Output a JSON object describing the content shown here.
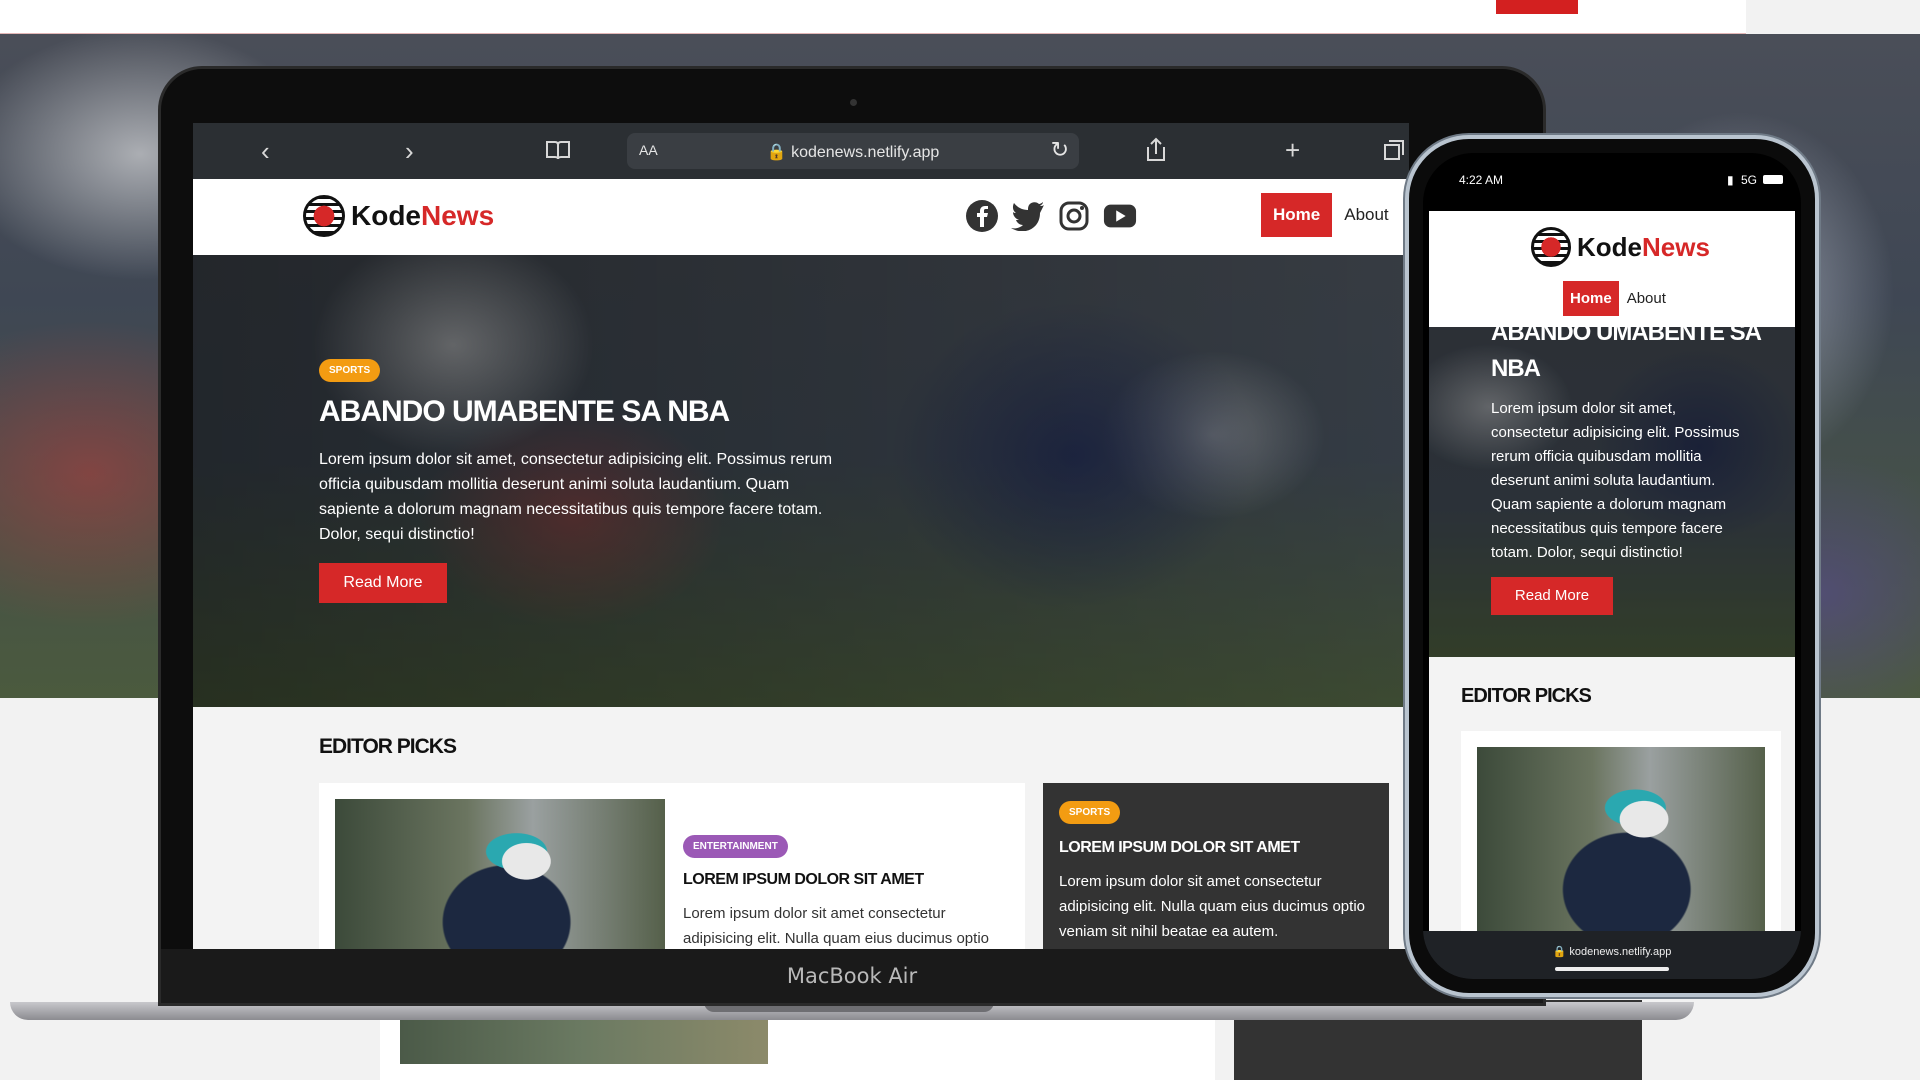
{
  "browser": {
    "url": "kodenews.netlify.app",
    "aa_label": "AA",
    "icons": [
      "back-icon",
      "forward-icon",
      "bookmarks-icon",
      "share-icon",
      "new-tab-icon",
      "tabs-icon"
    ]
  },
  "site": {
    "logo_kode": "Kode",
    "logo_news": "News",
    "social_icons": [
      "facebook-icon",
      "twitter-icon",
      "instagram-icon",
      "youtube-icon"
    ],
    "nav": {
      "home": "Home",
      "about": "About"
    },
    "colors": {
      "brand_red": "#d62828",
      "sports_orange": "#f39c12",
      "entertainment_purple": "#9b59b6",
      "dark_card": "#333333"
    }
  },
  "hero": {
    "badge": "SPORTS",
    "title": "ABANDO UMABENTE SA NBA",
    "description": "Lorem ipsum dolor sit amet, consectetur adipisicing elit. Possimus rerum officia quibusdam mollitia deserunt animi soluta laudantium. Quam sapiente a dolorum magnam necessitatibus quis tempore facere totam. Dolor, sequi distinctio!",
    "button": "Read More"
  },
  "editor_picks": {
    "title": "EDITOR PICKS",
    "card1": {
      "badge": "ENTERTAINMENT",
      "title": "LOREM IPSUM DOLOR SIT AMET",
      "text": "Lorem ipsum dolor sit amet consectetur adipisicing elit. Nulla quam eius ducimus optio"
    },
    "card2": {
      "badge": "SPORTS",
      "title": "LOREM IPSUM DOLOR SIT AMET",
      "text": "Lorem ipsum dolor sit amet consectetur adipisicing elit. Nulla quam eius ducimus optio veniam sit nihil beatae ea autem."
    }
  },
  "laptop": {
    "brand": "MacBook Air"
  },
  "phone": {
    "time": "4:22 AM",
    "network": "5G",
    "hero_title_line1": "ABANDO UMABENTE SA",
    "hero_title_line2": "NBA",
    "url": "kodenews.netlify.app"
  }
}
